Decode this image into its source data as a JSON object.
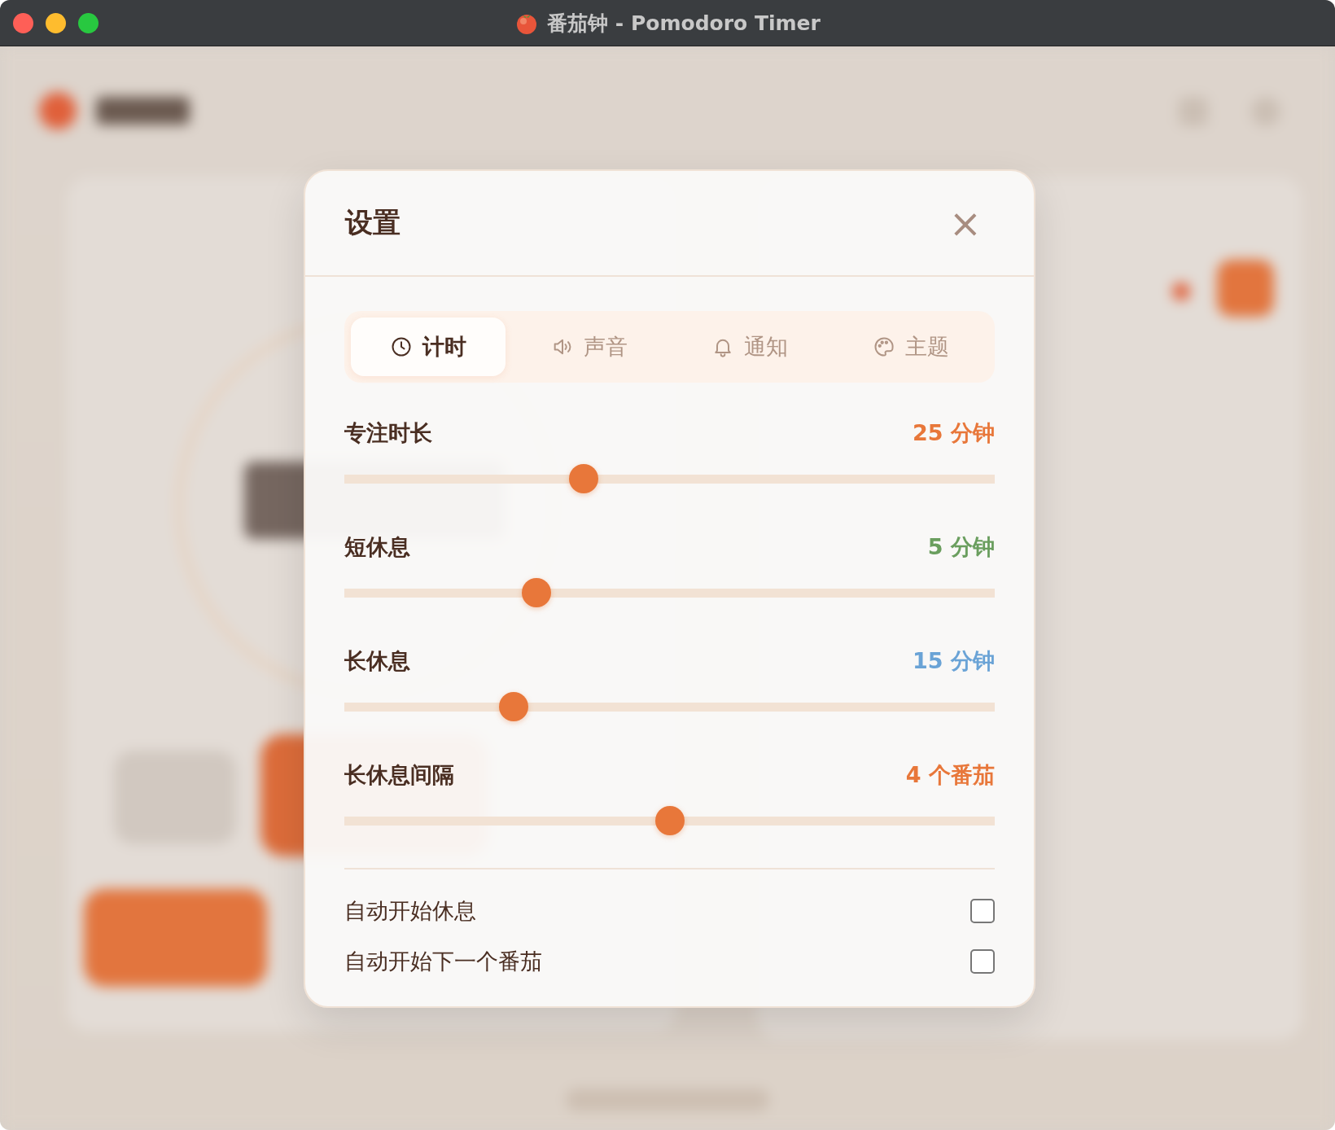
{
  "window": {
    "title": "番茄钟 - Pomodoro Timer"
  },
  "dialog": {
    "title": "设置",
    "close": "×"
  },
  "tabs": [
    {
      "label": "计时",
      "selected": true
    },
    {
      "label": "声音",
      "selected": false
    },
    {
      "label": "通知",
      "selected": false
    },
    {
      "label": "主题",
      "selected": false
    }
  ],
  "sliders": [
    {
      "label": "专注时长",
      "reading": "25 分钟",
      "level": 0.368,
      "color": "#e8773a"
    },
    {
      "label": "短休息",
      "reading": "5 分钟",
      "level": 0.295,
      "color": "#6a9e5e"
    },
    {
      "label": "长休息",
      "reading": "15 分钟",
      "level": 0.26,
      "color": "#6aa3d6"
    },
    {
      "label": "长休息间隔",
      "reading": "4 个番茄",
      "level": 0.5,
      "color": "#e8773a"
    }
  ],
  "toggles": [
    {
      "label": "自动开始休息",
      "checked": false
    },
    {
      "label": "自动开始下一个番茄",
      "checked": false
    }
  ]
}
